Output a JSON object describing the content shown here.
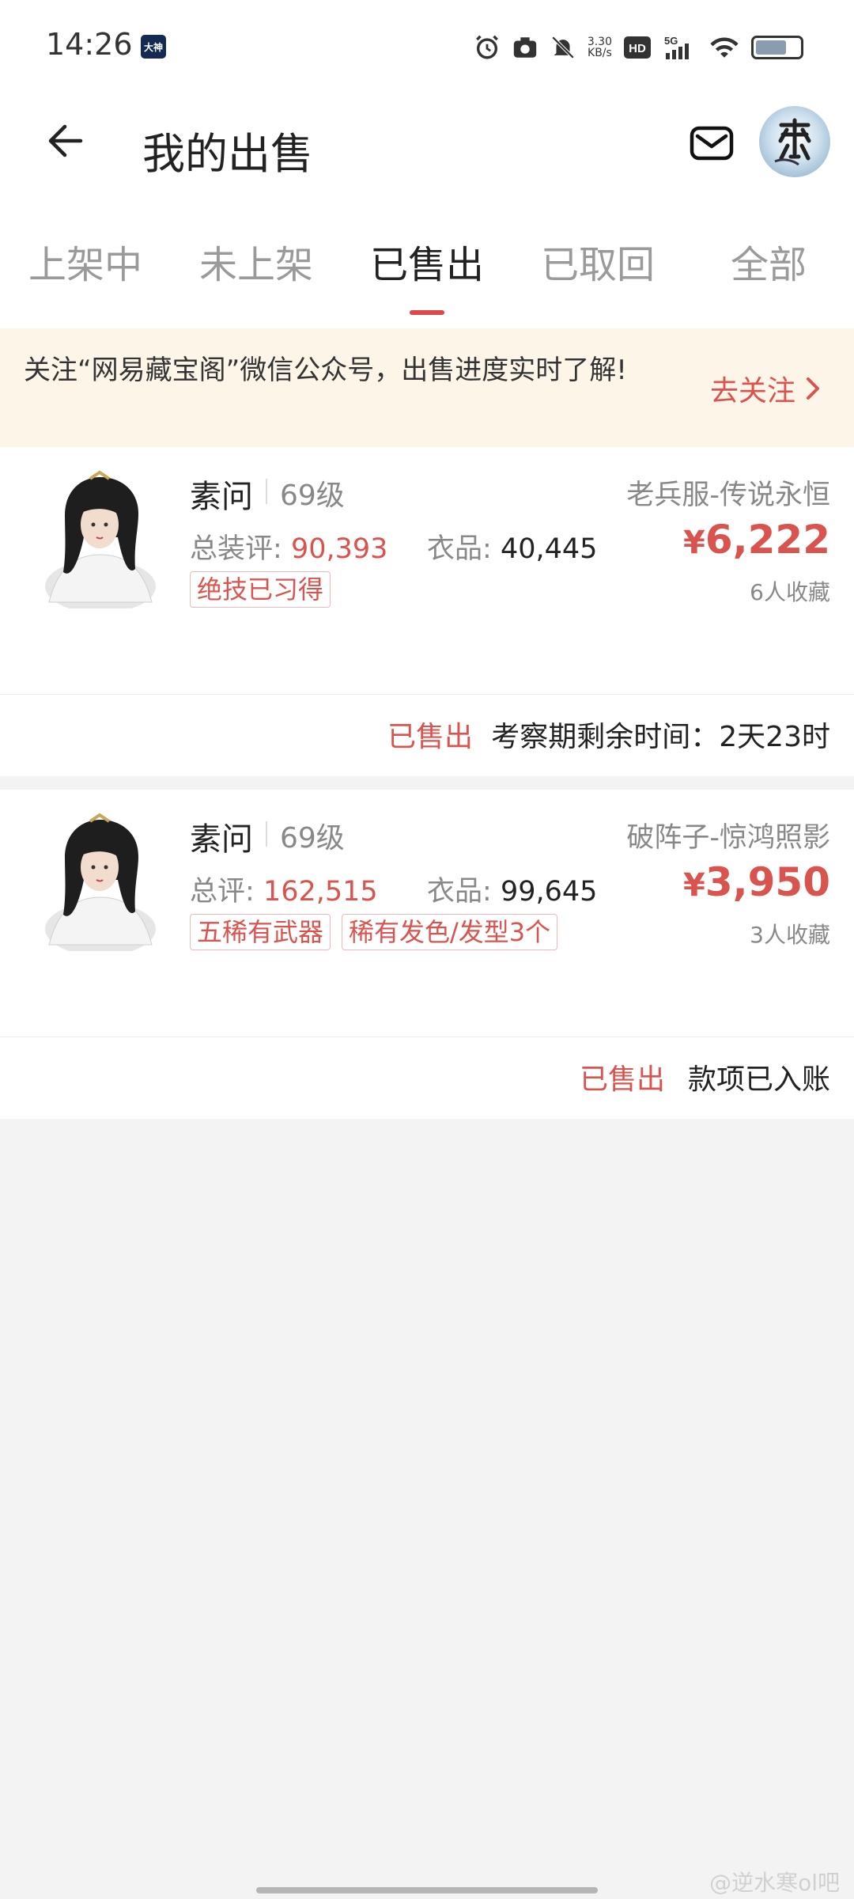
{
  "status_bar": {
    "time": "14:26",
    "app_badge": "大神",
    "net_speed_value": "3.30",
    "net_speed_unit": "KB/s",
    "hd_label": "HD",
    "signal_label": "5G"
  },
  "header": {
    "title": "我的出售"
  },
  "tabs": [
    {
      "label": "上架中",
      "active": false
    },
    {
      "label": "未上架",
      "active": false
    },
    {
      "label": "已售出",
      "active": true
    },
    {
      "label": "已取回",
      "active": false
    },
    {
      "label": "全部",
      "active": false
    }
  ],
  "notice": {
    "text": "关注“网易藏宝阁”微信公众号，出售进度实时了解!",
    "action": "去关注"
  },
  "listings": [
    {
      "name": "素问",
      "level": "69级",
      "server": "老兵服-传说永恒",
      "stat1_label": "总装评:",
      "stat1_value": "90,393",
      "stat2_label": "衣品:",
      "stat2_value": "40,445",
      "price_symbol": "¥",
      "price": "6,222",
      "favorites": "6人收藏",
      "tags": [
        "绝技已习得"
      ],
      "status": "已售出",
      "status_info": "考察期剩余时间：2天23时"
    },
    {
      "name": "素问",
      "level": "69级",
      "server": "破阵子-惊鸿照影",
      "stat1_label": "总评:",
      "stat1_value": "162,515",
      "stat2_label": "衣品:",
      "stat2_value": "99,645",
      "price_symbol": "¥",
      "price": "3,950",
      "favorites": "3人收藏",
      "tags": [
        "五稀有武器",
        "稀有发色/发型3个"
      ],
      "status": "已售出",
      "status_info": "款项已入账"
    }
  ],
  "watermark": "@逆水寒ol吧",
  "colors": {
    "accent_red": "#d9534f",
    "notice_bg": "#fdf6e8",
    "page_bg": "#f3f3f3"
  }
}
